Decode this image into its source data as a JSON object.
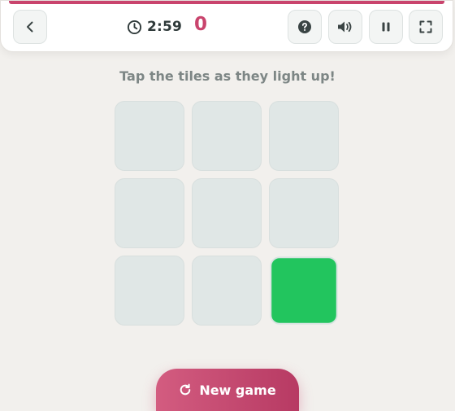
{
  "header": {
    "timer": "2:59",
    "score": "0",
    "accent_color": "#c9446d",
    "buttons": [
      {
        "name": "back",
        "icon": "chevron-left-icon"
      },
      {
        "name": "help",
        "icon": "question-circle-icon"
      },
      {
        "name": "sound",
        "icon": "speaker-icon"
      },
      {
        "name": "pause",
        "icon": "pause-icon"
      },
      {
        "name": "fullscreen",
        "icon": "fullscreen-icon"
      }
    ]
  },
  "game": {
    "instruction": "Tap the tiles as they light up!",
    "grid_size": 3,
    "tile_color": "#e0e7e6",
    "lit_color": "#22c55e",
    "lit_tile": 9
  },
  "footer": {
    "new_game_label": "New game",
    "new_game_icon": "restart-icon"
  }
}
